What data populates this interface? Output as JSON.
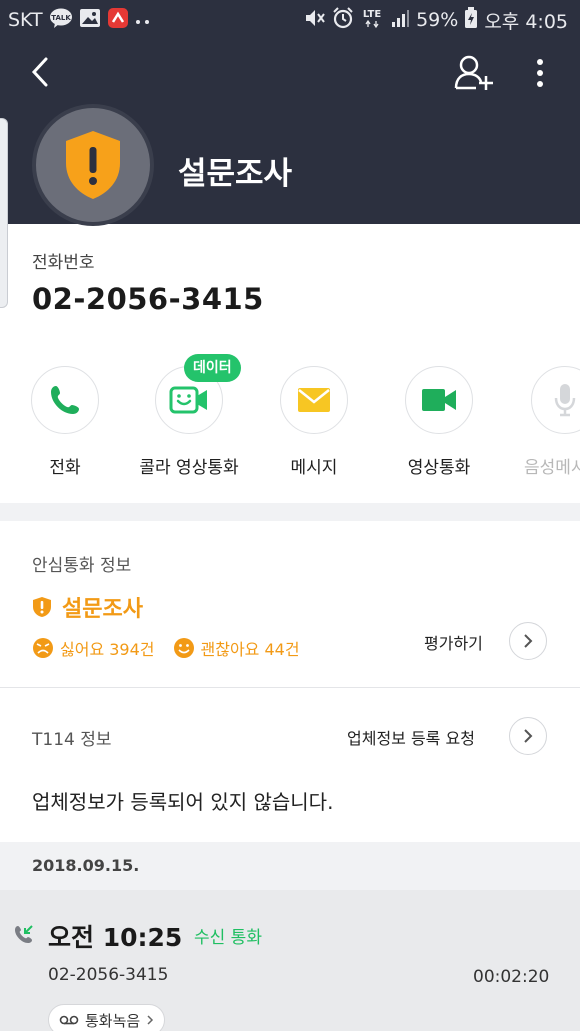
{
  "status_bar": {
    "carrier": "SKT",
    "icons_left": [
      "talk-icon",
      "gallery-icon",
      "app-icon",
      "more-dots-icon"
    ],
    "icons_right": [
      "mute-icon",
      "alarm-icon",
      "lte-icon",
      "signal-icon",
      "battery-icon"
    ],
    "lte_label": "LTE",
    "battery": "59%",
    "time": "오후 4:05"
  },
  "contact": {
    "name": "설문조사",
    "phone_label": "전화번호",
    "phone_number": "02-2056-3415"
  },
  "actions": [
    {
      "label": "전화",
      "icon": "phone-icon",
      "badge": "",
      "enabled": true
    },
    {
      "label": "콜라 영상통화",
      "icon": "colla-video-icon",
      "badge": "데이터",
      "enabled": true
    },
    {
      "label": "메시지",
      "icon": "message-icon",
      "badge": "",
      "enabled": true
    },
    {
      "label": "영상통화",
      "icon": "video-call-icon",
      "badge": "",
      "enabled": true
    },
    {
      "label": "음성메시",
      "icon": "voice-message-icon",
      "badge": "",
      "enabled": false
    }
  ],
  "safe_call": {
    "title": "안심통화 정보",
    "name": "설문조사",
    "dislike": "싫어요 394건",
    "like": "괜찮아요 44건",
    "rate_label": "평가하기"
  },
  "t114": {
    "title": "T114 정보",
    "request_label": "업체정보 등록 요청",
    "empty_message": "업체정보가 등록되어 있지 않습니다."
  },
  "history": {
    "date": "2018.09.15.",
    "calls": [
      {
        "time": "오전 10:25",
        "type": "수신 통화",
        "number": "02-2056-3415",
        "duration": "00:02:20",
        "record_label": "통화녹음"
      }
    ]
  },
  "colors": {
    "header_bg": "#2c303f",
    "accent_green": "#24c36b",
    "warning_orange": "#f29a16",
    "message_yellow": "#f7c623"
  }
}
